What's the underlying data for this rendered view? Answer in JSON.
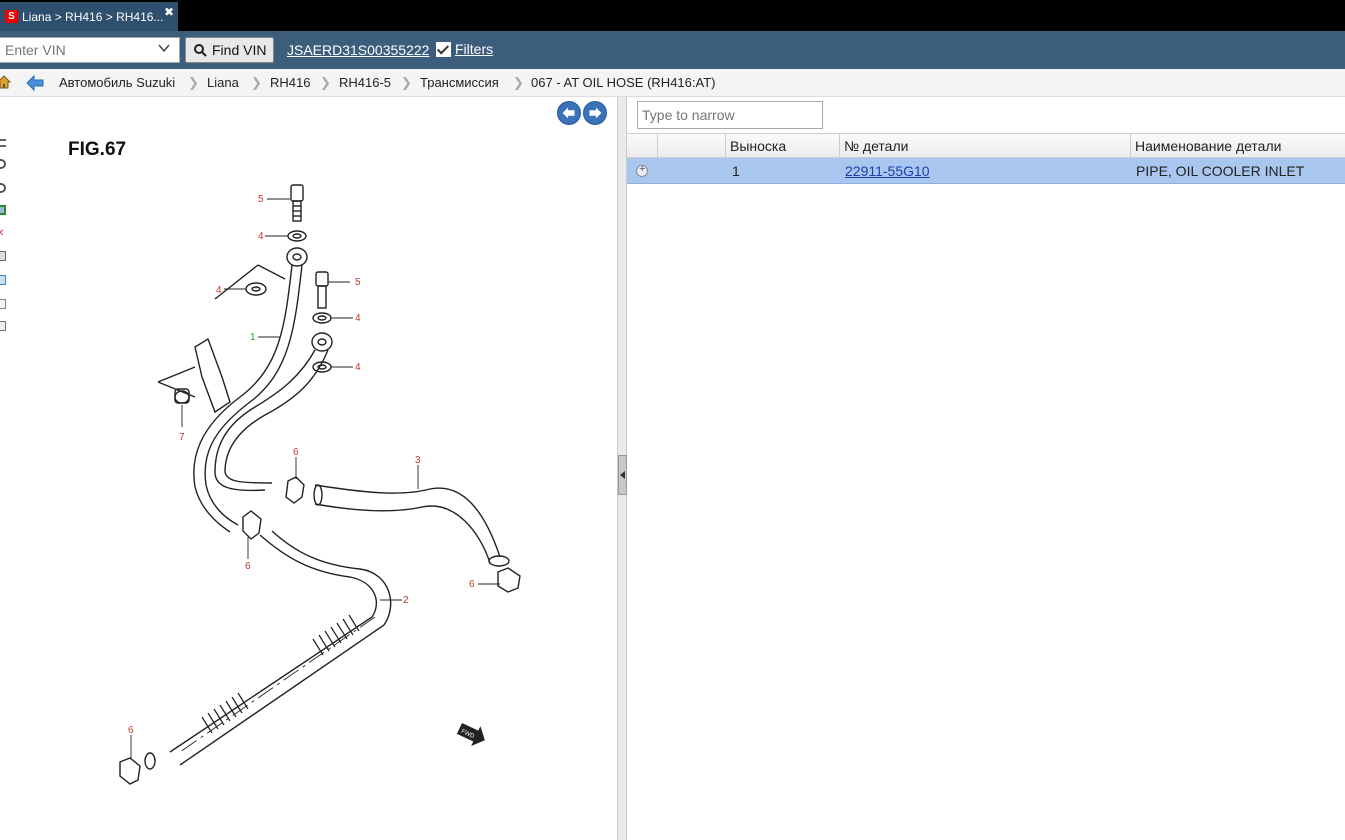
{
  "tab": {
    "title": "Liana > RH416 > RH416...",
    "logo": "S",
    "close": "✖"
  },
  "toolbar": {
    "vin_placeholder": "Enter VIN",
    "find_label": "Find VIN",
    "vin_value": "JSAERD31S00355222",
    "filters_label": "Filters",
    "filters_checked": true
  },
  "breadcrumb": [
    "Автомобиль Suzuki",
    "Liana",
    "RH416",
    "RH416-5",
    "Трансмиссия",
    "067 - AT OIL HOSE (RH416:AT)"
  ],
  "diagram": {
    "title": "FIG.67",
    "callouts": [
      "5",
      "4",
      "4",
      "5",
      "4",
      "1",
      "4",
      "7",
      "6",
      "3",
      "6",
      "6",
      "2",
      "6"
    ],
    "fwd_label": "FWD"
  },
  "search": {
    "placeholder": "Type to narrow"
  },
  "table": {
    "columns": [
      "",
      "",
      "Выноска",
      "№ детали",
      "Наименование детали"
    ],
    "rows": [
      {
        "callout": "1",
        "part_number": "22911-55G10",
        "name": "PIPE, OIL COOLER INLET"
      }
    ]
  },
  "colors": {
    "toolbar": "#3d5d7d",
    "selected_row": "#a9c7ee",
    "link": "#1a3fb0",
    "callout": "#c0392b"
  }
}
